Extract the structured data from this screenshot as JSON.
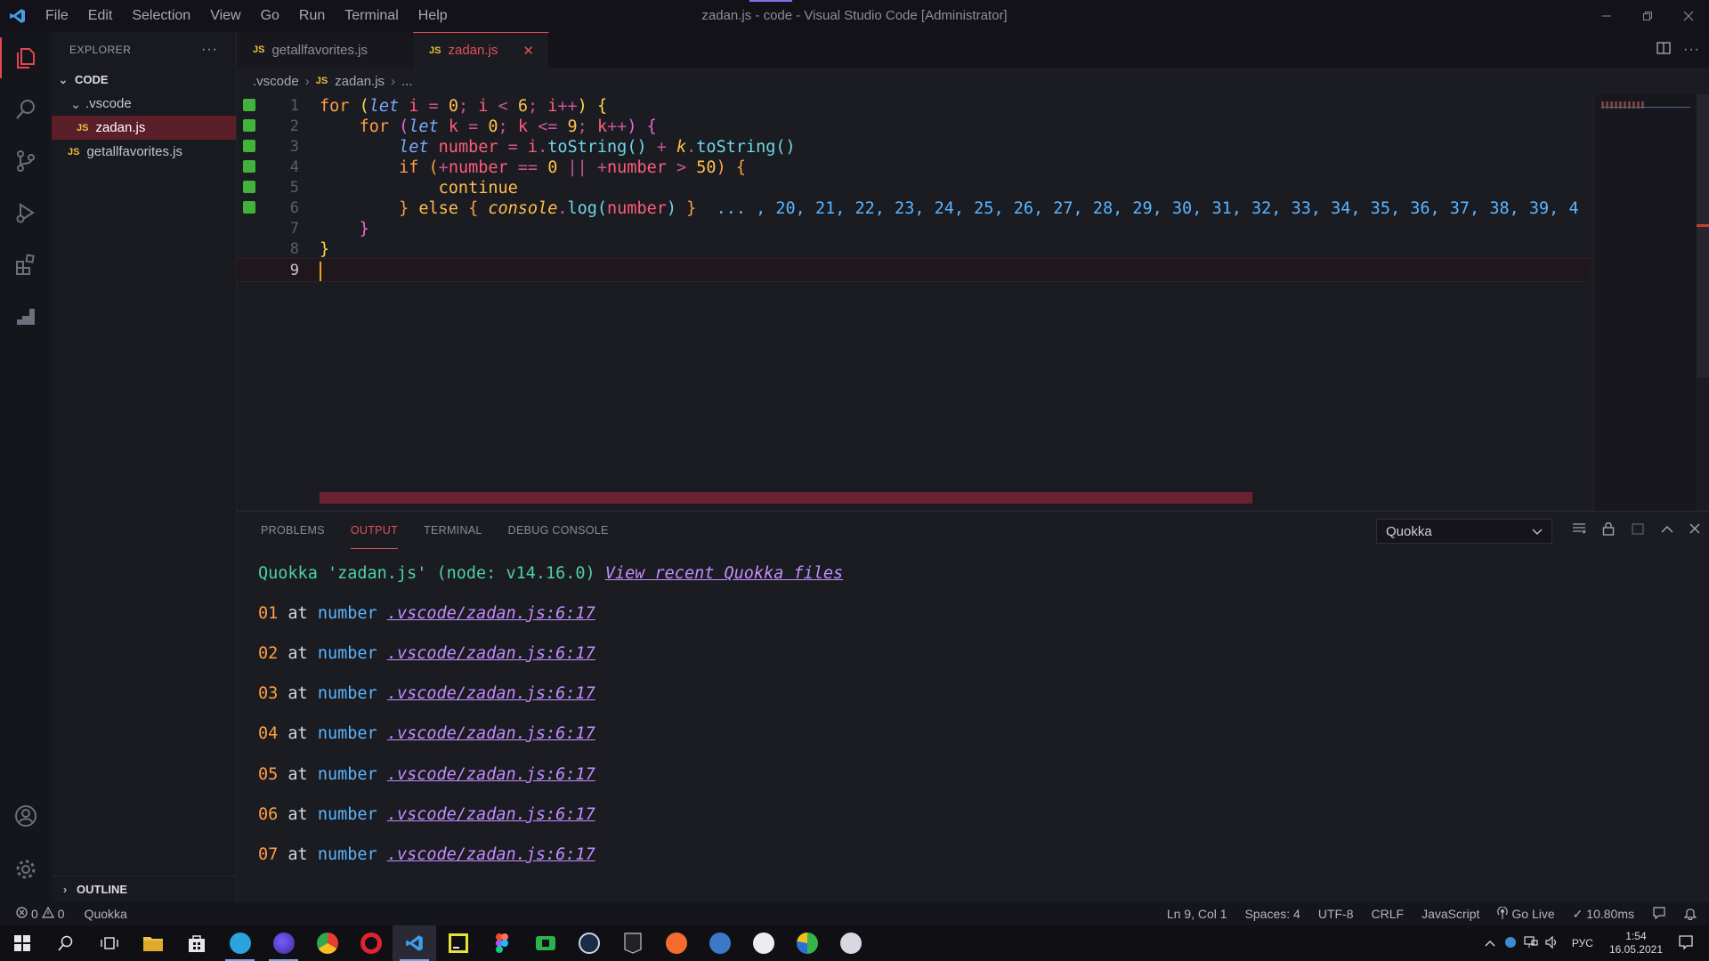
{
  "window": {
    "title": "zadan.js - code - Visual Studio Code [Administrator]",
    "menu": [
      "File",
      "Edit",
      "Selection",
      "View",
      "Go",
      "Run",
      "Terminal",
      "Help"
    ]
  },
  "sidebar": {
    "header": "EXPLORER",
    "root": "CODE",
    "folder": ".vscode",
    "files": [
      {
        "name": "zadan.js",
        "badge": "JS"
      },
      {
        "name": "getallfavorites.js",
        "badge": "JS"
      }
    ],
    "outline": "OUTLINE"
  },
  "tabs": [
    {
      "badge": "JS",
      "label": "getallfavorites.js"
    },
    {
      "badge": "JS",
      "label": "zadan.js",
      "close": "✕"
    }
  ],
  "breadcrumb": {
    "folder": ".vscode",
    "badge": "JS",
    "file": "zadan.js",
    "more": "..."
  },
  "editor": {
    "line_numbers": [
      "1",
      "2",
      "3",
      "4",
      "5",
      "6",
      "7",
      "8",
      "9"
    ],
    "tokens": {
      "for": "for",
      "let": "let",
      "i": "i",
      "k": "k",
      "zero": "0",
      "six": "6",
      "nine": "9",
      "fifty": "50",
      "number": "number",
      "toString": "toString",
      "if": "if",
      "continue": "continue",
      "else": "else",
      "console": "console",
      "log": "log"
    },
    "inline_result": "... , 20, 21, 22, 23, 24, 25, 26, 27, 28, 29, 30, 31, 32, 33, 34, 35, 36, 37, 38, 39, 4"
  },
  "panel": {
    "tabs": [
      "PROBLEMS",
      "OUTPUT",
      "TERMINAL",
      "DEBUG CONSOLE"
    ],
    "active_tab": "OUTPUT",
    "output_channel": "Quokka",
    "header_text": "Quokka 'zadan.js' (node: v14.16.0)",
    "header_link": "View recent Quokka files",
    "entries": [
      {
        "value": "01",
        "at": "at",
        "var": "number",
        "link": ".vscode/zadan.js:6:17"
      },
      {
        "value": "02",
        "at": "at",
        "var": "number",
        "link": ".vscode/zadan.js:6:17"
      },
      {
        "value": "03",
        "at": "at",
        "var": "number",
        "link": ".vscode/zadan.js:6:17"
      },
      {
        "value": "04",
        "at": "at",
        "var": "number",
        "link": ".vscode/zadan.js:6:17"
      },
      {
        "value": "05",
        "at": "at",
        "var": "number",
        "link": ".vscode/zadan.js:6:17"
      },
      {
        "value": "06",
        "at": "at",
        "var": "number",
        "link": ".vscode/zadan.js:6:17"
      },
      {
        "value": "07",
        "at": "at",
        "var": "number",
        "link": ".vscode/zadan.js:6:17"
      }
    ]
  },
  "statusbar": {
    "errors": "0",
    "warnings": "0",
    "quokka": "Quokka",
    "position": "Ln 9, Col 1",
    "spaces": "Spaces: 4",
    "encoding": "UTF-8",
    "eol": "CRLF",
    "language": "JavaScript",
    "golive": "Go Live",
    "timing": "✓ 10.80ms"
  },
  "taskbar": {
    "lang": "РУС",
    "time": "1:54",
    "date": "16.05.2021"
  },
  "colors": {
    "accent": "#e0484e",
    "background": "#1b1b22",
    "gutter_marker": "#41b33a"
  }
}
